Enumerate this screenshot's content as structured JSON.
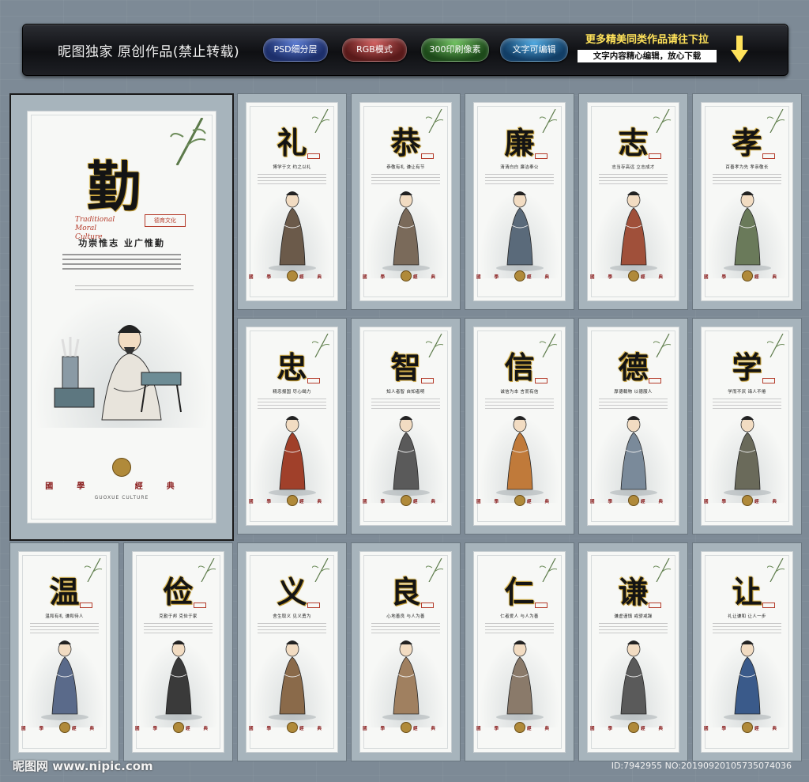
{
  "banner": {
    "brand": "昵图独家 原创作品(禁止转载)",
    "pills": [
      "PSD细分层",
      "RGB模式",
      "300印刷像素",
      "文字可编辑"
    ],
    "more": "更多精美同类作品请往下拉",
    "more_sub": "文字内容精心编辑，放心下载"
  },
  "big_panel": {
    "character": "勤",
    "subtitle_latin": "Traditional Moral Culture",
    "seal": "德育文化",
    "motto": "功崇惟志 业广惟勤",
    "footer": "國學 經典",
    "footer_latin": "GUOXUE CULTURE"
  },
  "panels": [
    {
      "character": "礼",
      "motto": "博学于文 约之以礼"
    },
    {
      "character": "恭",
      "motto": "恭敬有礼 谦让有节"
    },
    {
      "character": "廉",
      "motto": "清清白白 廉洁奉公"
    },
    {
      "character": "志",
      "motto": "志当存高远 立志成才"
    },
    {
      "character": "孝",
      "motto": "百善孝为先 孝亲敬长"
    },
    {
      "character": "忠",
      "motto": "精忠报国 尽心竭力"
    },
    {
      "character": "智",
      "motto": "知人者智 自知者明"
    },
    {
      "character": "信",
      "motto": "诚信为本 言而有信"
    },
    {
      "character": "德",
      "motto": "厚德载物 以德服人"
    },
    {
      "character": "学",
      "motto": "学而不厌 诲人不倦"
    },
    {
      "character": "温",
      "motto": "温和有礼 谦和待人"
    },
    {
      "character": "俭",
      "motto": "克勤于邦 克俭于家"
    },
    {
      "character": "义",
      "motto": "舍生取义 见义勇为"
    },
    {
      "character": "良",
      "motto": "心地善良 与人为善"
    },
    {
      "character": "仁",
      "motto": "仁者爱人 与人为善"
    },
    {
      "character": "谦",
      "motto": "谦虚谨慎 戒骄戒躁"
    },
    {
      "character": "让",
      "motto": "礼让谦和 让人一步"
    }
  ],
  "panel_footer": "國學 經典",
  "watermark": {
    "left": "昵图网 www.nipic.com",
    "right": "ID:7942955 NO:20190920105735074036"
  }
}
